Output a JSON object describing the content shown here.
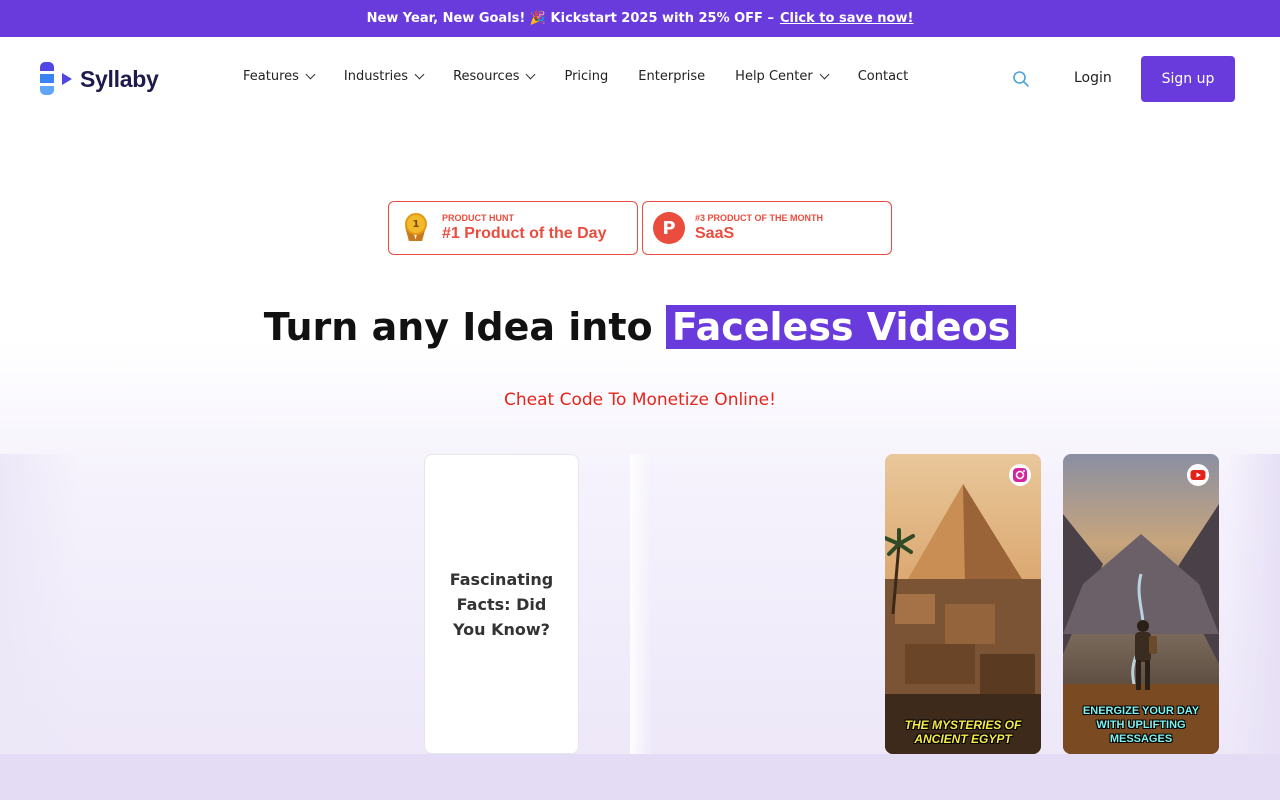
{
  "promo": {
    "text": "New Year, New Goals! 🎉 Kickstart 2025 with 25% OFF –",
    "link": "Click to save now!"
  },
  "nav": {
    "logo_text": "Syllaby",
    "items": [
      {
        "label": "Features",
        "dropdown": true
      },
      {
        "label": "Industries",
        "dropdown": true
      },
      {
        "label": "Resources",
        "dropdown": true
      },
      {
        "label": "Pricing",
        "dropdown": false
      },
      {
        "label": "Enterprise",
        "dropdown": false
      },
      {
        "label": "Help Center",
        "dropdown": true
      },
      {
        "label": "Contact",
        "dropdown": false
      }
    ],
    "search_icon": "search-icon",
    "login": "Login",
    "signup": "Sign up"
  },
  "badges": [
    {
      "small": "PRODUCT HUNT",
      "big": "#1 Product of the Day",
      "medal_number": "1",
      "icon": "medal-icon"
    },
    {
      "small": "#3 PRODUCT OF THE MONTH",
      "big": "SaaS",
      "ph_letter": "P",
      "icon": "producthunt-icon"
    }
  ],
  "hero": {
    "headline_plain": "Turn any Idea into",
    "headline_highlight": "Faceless Videos",
    "tagline": "Cheat Code To Monetize Online!"
  },
  "cards": {
    "text_card": "Fascinating Facts: Did You Know?",
    "egypt_caption_1": "THE MYSTERIES OF",
    "egypt_caption_2": "ANCIENT EGYPT",
    "egypt_platform_icon": "instagram-icon",
    "hiker_caption_1": "ENERGIZE YOUR DAY",
    "hiker_caption_2": "WITH UPLIFTING",
    "hiker_caption_3": "MESSAGES",
    "hiker_platform_icon": "youtube-icon"
  },
  "colors": {
    "brand": "#6a3bdc",
    "producthunt": "#ea4c3d",
    "tagline": "#e5241b"
  }
}
